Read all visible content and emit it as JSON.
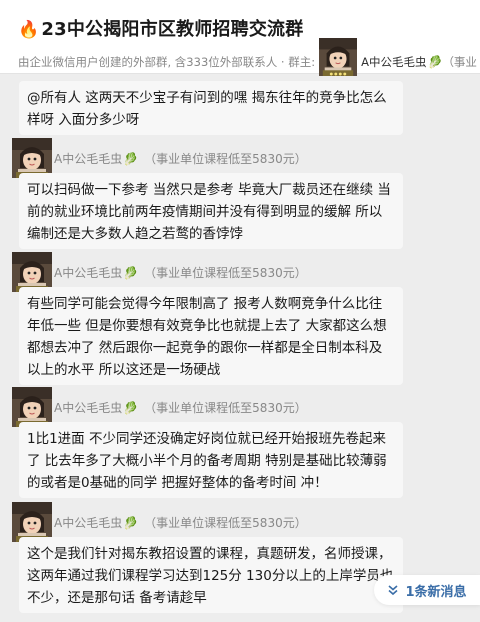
{
  "header": {
    "fire_emoji": "🔥",
    "title": "23中公揭阳市区教师招聘交流群",
    "subtitle_prefix": "由企业微信用户创建的外部群, 含333位外部联系人 · 群主:",
    "owner_name": "A中公毛毛虫",
    "subtitle_suffix": "（事业"
  },
  "messages": [
    {
      "text": "@所有人  这两天不少宝子有问到的嘿 揭东往年的竞争比怎么样呀 入面分多少呀"
    },
    {
      "sender": "A中公毛毛虫",
      "sender_note": "（事业单位课程低至5830元）",
      "text": "可以扫码做一下参考 当然只是参考 毕竟大厂裁员还在继续 当前的就业环境比前两年疫情期间并没有得到明显的缓解  所以编制还是大多数人趋之若鹜的香饽饽"
    },
    {
      "sender": "A中公毛毛虫",
      "sender_note": "（事业单位课程低至5830元）",
      "text": "有些同学可能会觉得今年限制高了 报考人数啊竞争什么比往年低一些 但是你要想有效竞争比也就提上去了 大家都这么想都想去冲了 然后跟你一起竞争的跟你一样都是全日制本科及以上的水平 所以这还是一场硬战"
    },
    {
      "sender": "A中公毛毛虫",
      "sender_note": "（事业单位课程低至5830元）",
      "text": "1比1进面 不少同学还没确定好岗位就已经开始报班先卷起来了 比去年多了大概小半个月的备考周期 特别是基础比较薄弱的或者是0基础的同学 把握好整体的备考时间 冲！"
    },
    {
      "sender": "A中公毛毛虫",
      "sender_note": "（事业单位课程低至5830元）",
      "text": "这个是我们针对揭东教招设置的课程，真题研发，名师授课，这两年通过我们课程学习达到125分 130分以上的上岸学员也不少，还是那句话 备考请趁早"
    }
  ],
  "leaf_emoji": "🥬",
  "new_messages_label": "1条新消息",
  "colors": {
    "background": "#ededed",
    "bubble": "#f7f7f7",
    "link_blue": "#3b6ea8"
  }
}
